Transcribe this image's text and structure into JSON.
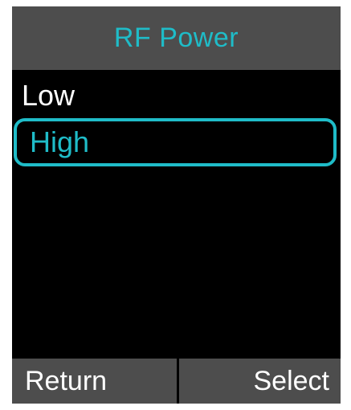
{
  "header": {
    "title": "RF Power"
  },
  "menu": {
    "items": [
      {
        "label": "Low",
        "selected": false
      },
      {
        "label": "High",
        "selected": true
      }
    ]
  },
  "softkeys": {
    "left_label": "Return",
    "right_label": "Select"
  },
  "colors": {
    "accent": "#1fbcc8",
    "bar_background": "#4d4d4d",
    "screen_background": "#000000",
    "text": "#ffffff"
  }
}
